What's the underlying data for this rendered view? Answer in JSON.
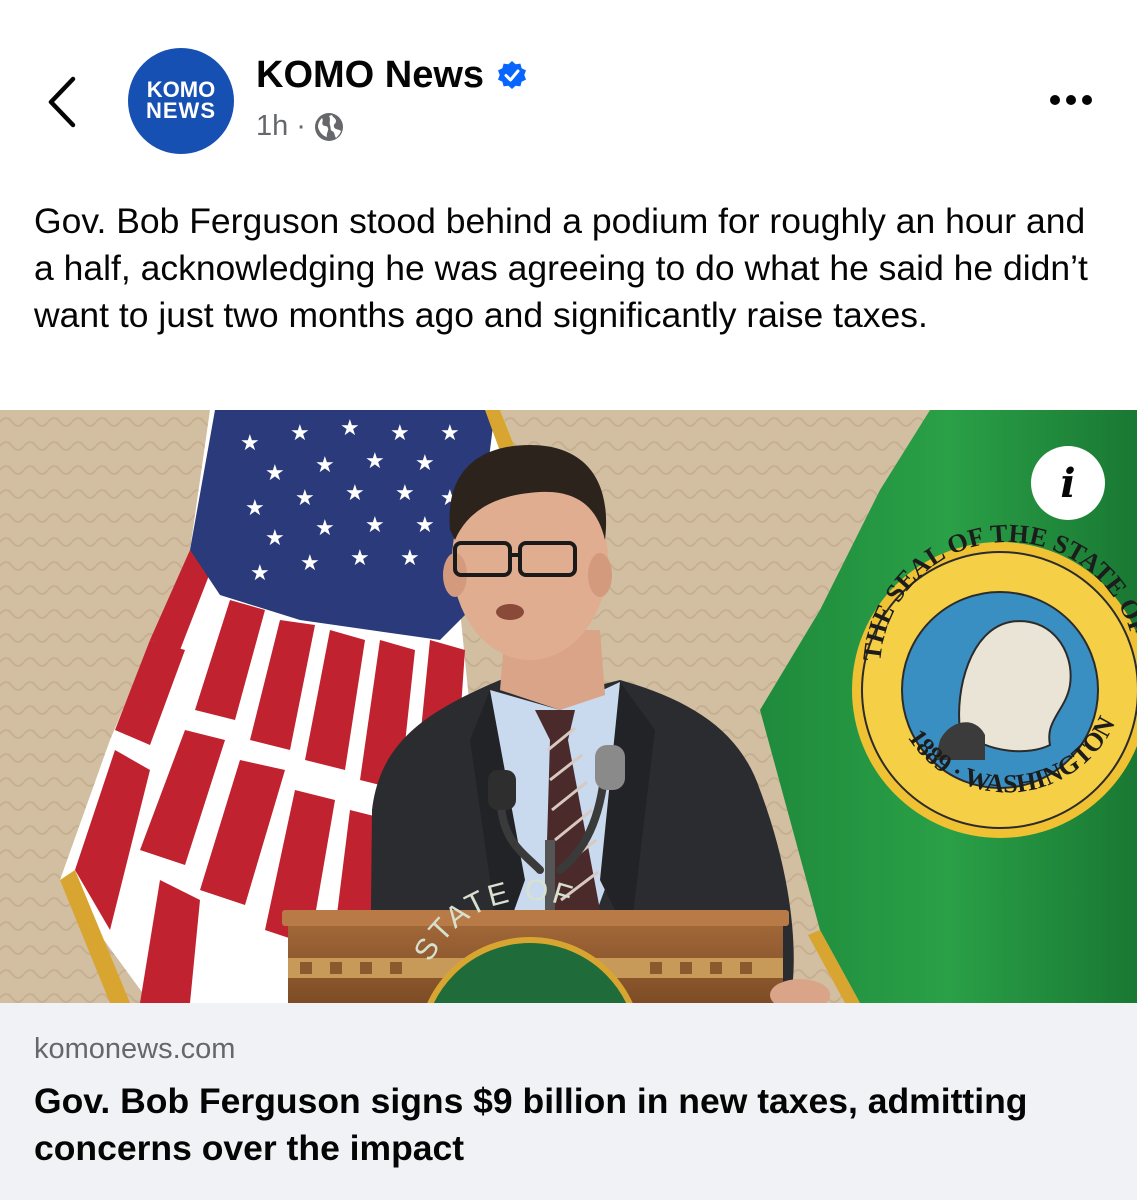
{
  "header": {
    "page_name": "KOMO News",
    "avatar_line1": "KOMO",
    "avatar_line2": "NEWS",
    "timestamp": "1h",
    "separator": "·",
    "audience_icon": "globe-icon",
    "back_icon": "chevron-left-icon",
    "more_icon": "more-horizontal-icon",
    "verified_icon": "verified-badge-icon"
  },
  "post": {
    "text": "Gov. Bob Ferguson stood behind a podium for roughly an hour and a half, acknowledging he was agreeing to do what he said he didn’t want to just two months ago and significantly raise taxes."
  },
  "image": {
    "info_label": "i",
    "seal_top_text": "THE SEAL OF THE STATE OF",
    "seal_bottom_text": "WASHINGTON",
    "seal_year": "1889",
    "podium_text": "STATE OF"
  },
  "link": {
    "domain": "komonews.com",
    "title": "Gov. Bob Ferguson signs $9 billion in new taxes, admitting concerns over the impact"
  },
  "colors": {
    "brand_blue": "#1750b3",
    "verified_blue": "#0866ff",
    "secondary_text": "#65676b",
    "footer_bg": "#f0f2f5"
  }
}
